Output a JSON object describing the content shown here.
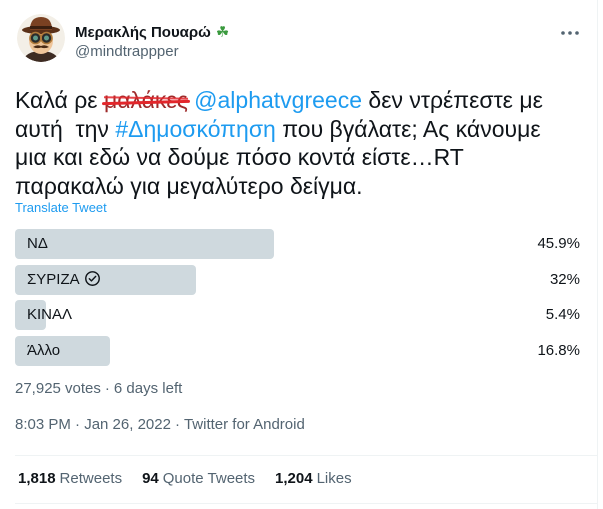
{
  "colors": {
    "text": "#0f1419",
    "secondary": "#536471",
    "link": "#1d9bf0",
    "poll_bar": "#cfd9de",
    "divider": "#eff3f4",
    "strike": "#e3262b",
    "shamrock": "#3a9a3e"
  },
  "tweet": {
    "author": {
      "display_name": "Μερακλής Πουαρώ",
      "name_emoji": "☘",
      "handle": "@mindtrappper"
    },
    "more_icon": "more-options-icon",
    "body_lines": [
      [
        "Καλά ρε ",
        "μαλάκες",
        " ",
        "@alphatvgreece",
        " δεν ντρέπεστε με"
      ],
      [
        "αυτή  την ",
        "#Δημοσκόπηση",
        " που βγάλατε; Ας κάνουμε"
      ],
      [
        "μια και εδώ να δούμε πόσο κοντά είστε…RT"
      ],
      [
        "παρακαλώ για μεγαλύτερο δείγμα."
      ]
    ],
    "translate_label": "Translate Tweet",
    "poll": {
      "voted_icon": "check-circle-icon",
      "options": [
        {
          "label": "ΝΔ",
          "percent_label": "45.9%",
          "percent": 45.9,
          "voted": false
        },
        {
          "label": "ΣΥΡΙΖΑ",
          "percent_label": "32%",
          "percent": 32,
          "voted": true
        },
        {
          "label": "ΚΙΝΑΛ",
          "percent_label": "5.4%",
          "percent": 5.4,
          "voted": false
        },
        {
          "label": "Άλλο",
          "percent_label": "16.8%",
          "percent": 16.8,
          "voted": false
        }
      ],
      "votes": "27,925 votes",
      "separator": "·",
      "time_left": "6 days left"
    },
    "timestamp": {
      "time": "8:03 PM · Jan 26, 2022",
      "separator": "·",
      "source": "Twitter for Android"
    },
    "stats": [
      {
        "count": "1,818",
        "label": "Retweets"
      },
      {
        "count": "94",
        "label": "Quote Tweets"
      },
      {
        "count": "1,204",
        "label": "Likes"
      }
    ]
  }
}
